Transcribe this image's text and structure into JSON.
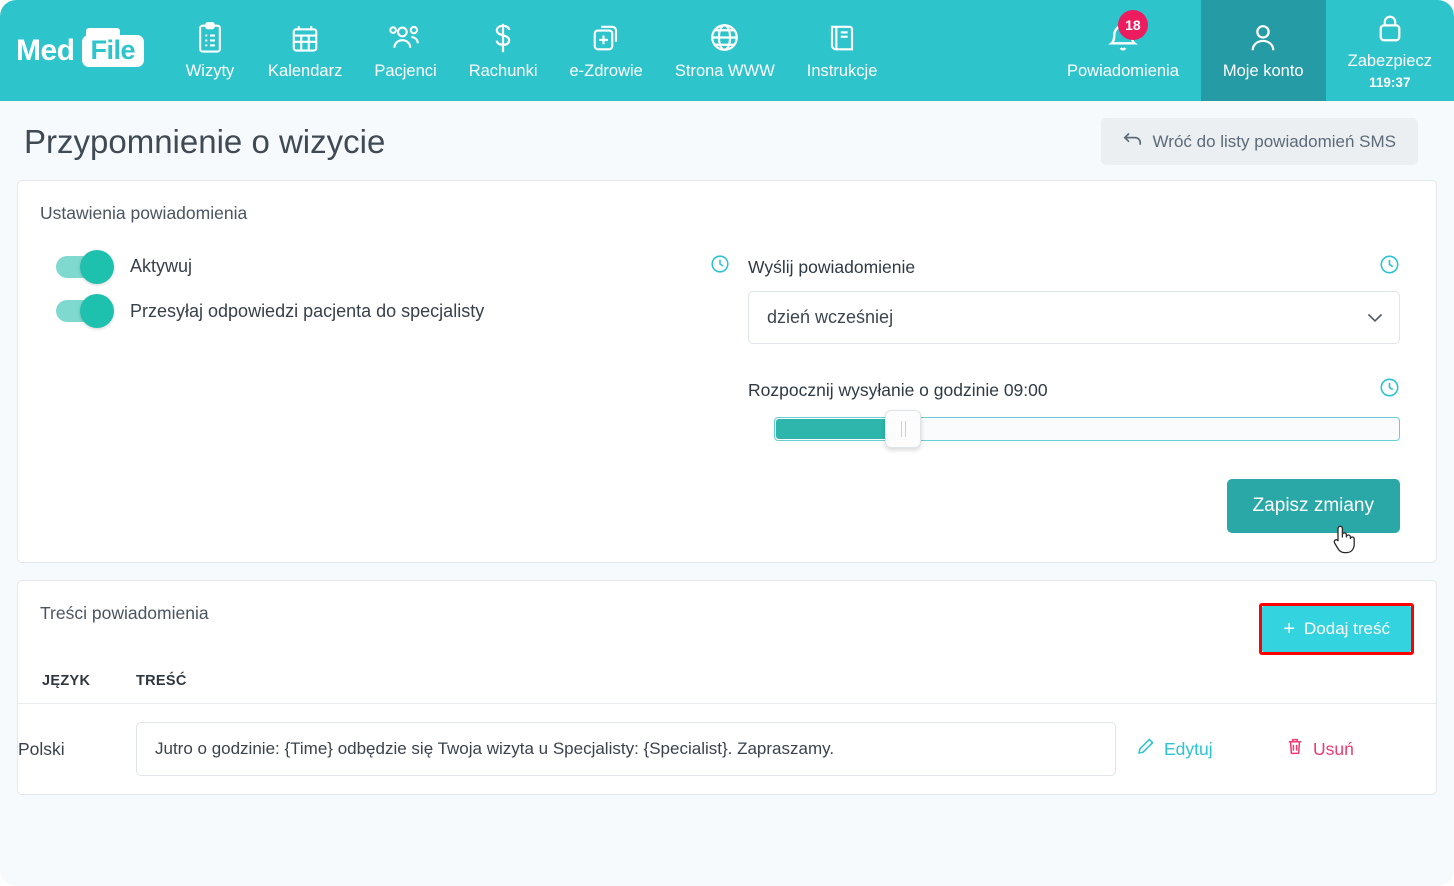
{
  "header": {
    "logo": {
      "med": "Med",
      "file": "File"
    },
    "nav": [
      {
        "label": "Wizyty",
        "icon": "clipboard-icon"
      },
      {
        "label": "Kalendarz",
        "icon": "calendar-icon"
      },
      {
        "label": "Pacjenci",
        "icon": "users-icon"
      },
      {
        "label": "Rachunki",
        "icon": "dollar-icon"
      },
      {
        "label": "e-Zdrowie",
        "icon": "medical-file-plus-icon"
      },
      {
        "label": "Strona WWW",
        "icon": "globe-icon"
      },
      {
        "label": "Instrukcje",
        "icon": "book-icon"
      }
    ],
    "right": {
      "notifications": {
        "label": "Powiadomienia",
        "badge": "18",
        "icon": "bell-icon"
      },
      "account": {
        "label": "Moje konto",
        "icon": "user-icon",
        "active": true
      },
      "secure": {
        "label": "Zabezpiecz",
        "timer": "119:37",
        "icon": "lock-icon"
      }
    }
  },
  "page": {
    "title": "Przypomnienie o wizycie",
    "back_button": "Wróć do listy powiadomień SMS"
  },
  "settings": {
    "title": "Ustawienia powiadomienia",
    "toggles": [
      {
        "label": "Aktywuj",
        "on": true
      },
      {
        "label": "Przesyłaj odpowiedzi pacjenta do specjalisty",
        "on": true
      }
    ],
    "send_label": "Wyślij powiadomienie",
    "send_value": "dzień wcześniej",
    "send_options": [
      "dzień wcześniej"
    ],
    "start_label": "Rozpocznij wysyłanie o godzinie 09:00",
    "start_time": "09:00",
    "save_button": "Zapisz zmiany"
  },
  "content": {
    "title": "Treści powiadomienia",
    "add_button": "Dodaj treść",
    "add_plus": "+",
    "columns": [
      "JĘZYK",
      "TREŚĆ"
    ],
    "rows": [
      {
        "language": "Polski",
        "text": "Jutro o godzinie: {Time} odbędzie się Twoja wizyta u Specjalisty: {Specialist}. Zapraszamy.",
        "edit": "Edytuj",
        "delete": "Usuń"
      }
    ]
  },
  "colors": {
    "header_teal": "#2ec4cc",
    "header_teal_dark": "#259ba5",
    "save_teal": "#2aa8a8",
    "add_cyan": "#34d3e0",
    "badge_pink": "#ec1c5e",
    "delete_pink": "#ef3b72",
    "highlight_red": "#ff0000",
    "page_bg": "#f7fafc"
  }
}
